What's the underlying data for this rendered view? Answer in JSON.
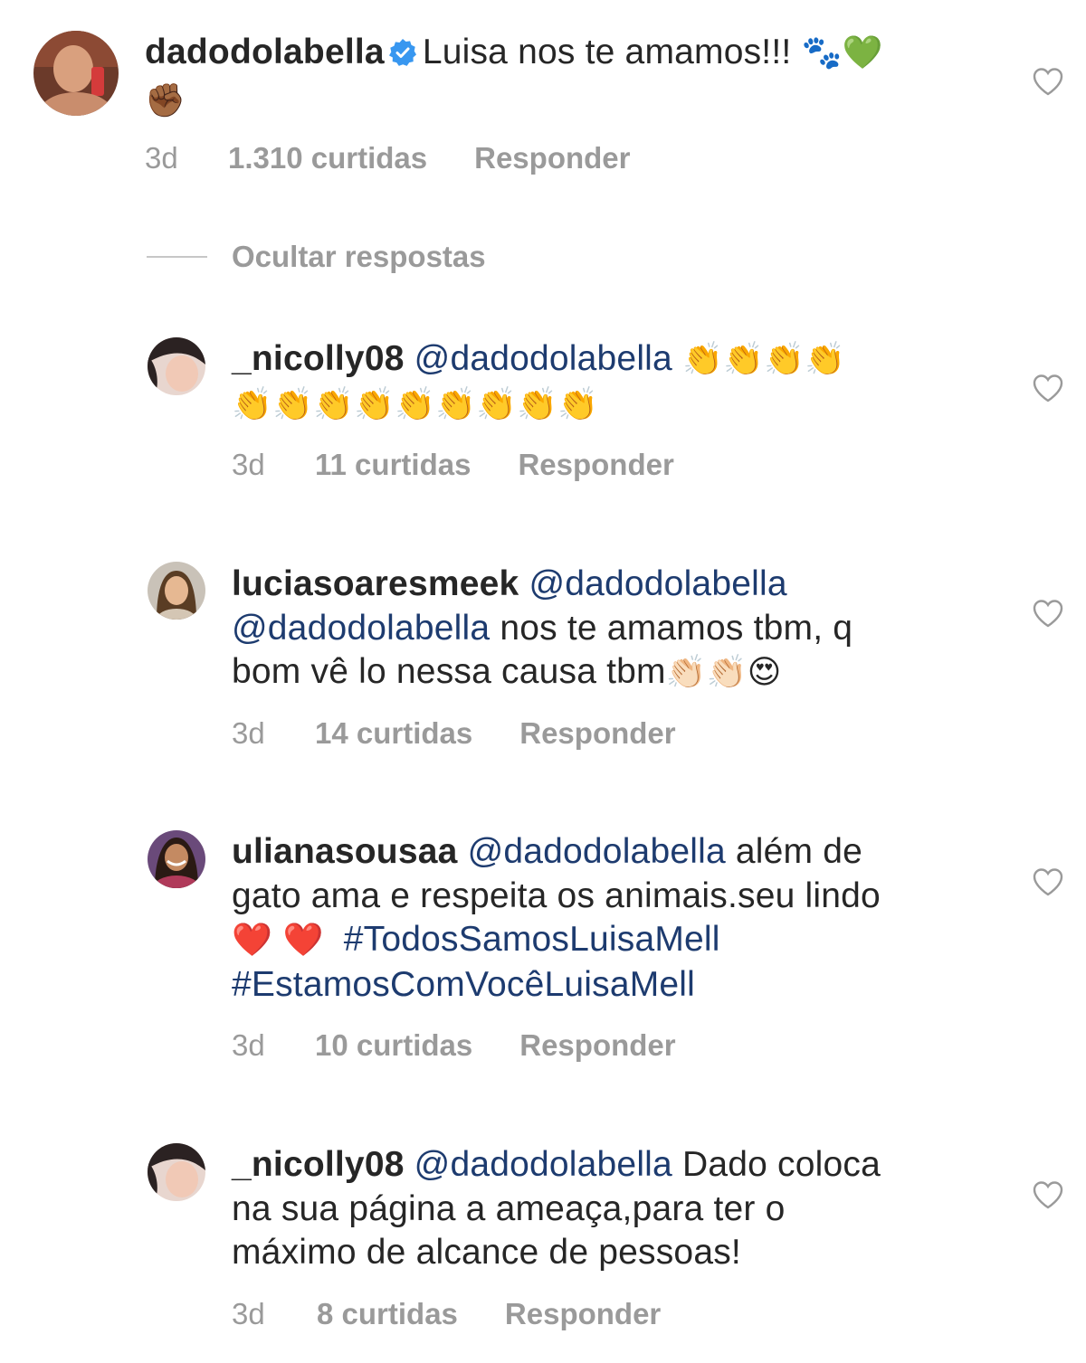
{
  "comments": [
    {
      "username": "dadodolabella",
      "verified": true,
      "text": "Luisa nos te amamos!!!",
      "emoji": "🐾💚",
      "emoji_line2": "✊🏾",
      "time": "3d",
      "likes": "1.310 curtidas",
      "reply": "Responder",
      "avatar": "avatar-photo-dark"
    },
    {
      "username": "_nicolly08",
      "mention": "@dadodolabella",
      "emoji_line1": "👏👏👏👏",
      "emoji_line2": "👏👏👏👏👏👏👏👏👏",
      "time": "3d",
      "likes": "11 curtidas",
      "reply": "Responder",
      "avatar": "avatar-photo-girl"
    },
    {
      "username": "luciasoaresmeek",
      "mention": "@dadodolabella",
      "line2_mention": "@dadodolabella",
      "line2_text": " nos te amamos tbm, q",
      "line3_text": "bom vê lo nessa causa tbm",
      "line3_emoji": "👏🏻👏🏻😍",
      "time": "3d",
      "likes": "14 curtidas",
      "reply": "Responder",
      "avatar": "avatar-photo-woman"
    },
    {
      "username": "ulianasousaa",
      "mention": "@dadodolabella",
      "line1_text": " além de",
      "line2_text": "gato ama e respeita os animais.seu lindo",
      "line3_emoji": "❤️ ❤️",
      "line3_tag": "#TodosSamosLuisaMell",
      "line4_tag": "#EstamosComVocêLuisaMell",
      "time": "3d",
      "likes": "10 curtidas",
      "reply": "Responder",
      "avatar": "avatar-photo-smile"
    },
    {
      "username": "_nicolly08",
      "mention": "@dadodolabella",
      "line1_text": " Dado coloca",
      "line2_text": "na sua página a ameaça,para ter o",
      "line3_text": "máximo de alcance de pessoas!",
      "time": "3d",
      "likes": "8 curtidas",
      "reply": "Responder",
      "avatar": "avatar-photo-girl"
    }
  ],
  "hide_replies": "Ocultar respostas",
  "colors": {
    "text": "#262626",
    "meta": "#9a9a9a",
    "link": "#1d3b6f",
    "verified": "#3897f0"
  },
  "icons": [
    "heart-icon",
    "verified-badge-icon"
  ]
}
